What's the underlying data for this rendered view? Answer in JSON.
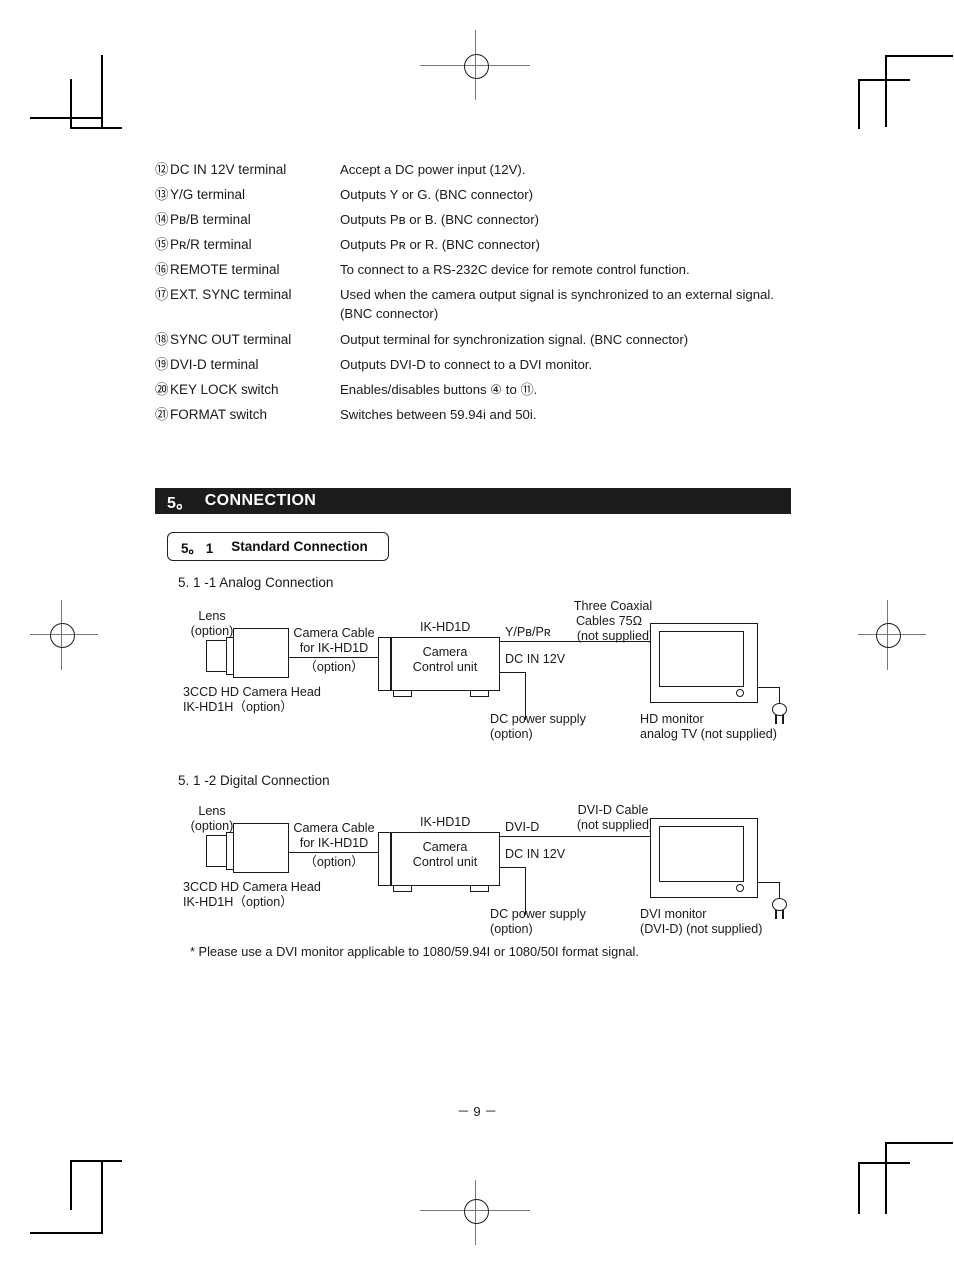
{
  "terminals": {
    "items": [
      {
        "num": "⑫",
        "name": "DC IN 12V terminal",
        "desc": "Accept a DC power input (12V)."
      },
      {
        "num": "⑬",
        "name": "Y/G terminal",
        "desc": "Outputs Y or G. (BNC connector)"
      },
      {
        "num": "⑭",
        "name": "Pʙ/B terminal",
        "desc": "Outputs Pʙ or B. (BNC connector)"
      },
      {
        "num": "⑮",
        "name": "Pʀ/R terminal",
        "desc": "Outputs Pʀ or R. (BNC connector)"
      },
      {
        "num": "⑯",
        "name": "REMOTE terminal",
        "desc": "To connect to a RS-232C device for remote control function."
      },
      {
        "num": "⑰",
        "name": "EXT. SYNC terminal",
        "desc": "Used when the camera output signal is synchronized to an external signal.",
        "desc2": "(BNC connector)"
      },
      {
        "num": "⑱",
        "name": "SYNC OUT terminal",
        "desc": "Output terminal for synchronization signal. (BNC connector)"
      },
      {
        "num": "⑲",
        "name": "DVI-D terminal",
        "desc": "Outputs DVI-D to connect to a DVI monitor."
      },
      {
        "num": "⑳",
        "name": "KEY LOCK switch",
        "desc": "Enables/disables buttons  ④  to  ⑪."
      },
      {
        "num": "㉑",
        "name": "FORMAT switch",
        "desc": "Switches between 59.94i and 50i."
      }
    ]
  },
  "section": {
    "number": "5。",
    "title": "CONNECTION",
    "banner_bg": "#1c1c1c",
    "banner_fg": "#ffffff"
  },
  "subsection": {
    "number": "5。 1",
    "title": "Standard Connection"
  },
  "analog": {
    "heading": "5. 1 -1   Analog Connection",
    "lens_label_1": "Lens",
    "lens_label_2": "(option)",
    "head_label_1": "3CCD HD Camera Head",
    "head_label_2": "IK-HD1H（option）",
    "cable_label_1": "Camera Cable",
    "cable_label_2": "for IK-HD1D",
    "cable_label_3": "（option）",
    "ccu_model": "IK-HD1D",
    "ccu_label_1": "Camera",
    "ccu_label_2": "Control unit",
    "out_label": "Y/Pʙ/Pʀ",
    "dc_label": "DC IN 12V",
    "coax_label_1": "Three Coaxial",
    "coax_label_2": "Cables 75Ω",
    "coax_label_3": "(not supplied)",
    "psu_label_1": "DC power supply",
    "psu_label_2": "(option)",
    "monitor_label_1": "HD monitor",
    "monitor_label_2": "analog TV (not supplied)"
  },
  "digital": {
    "heading": "5. 1 -2   Digital Connection",
    "lens_label_1": "Lens",
    "lens_label_2": "(option)",
    "head_label_1": "3CCD HD Camera Head",
    "head_label_2": "IK-HD1H（option）",
    "cable_label_1": "Camera Cable",
    "cable_label_2": "for IK-HD1D",
    "cable_label_3": "（option）",
    "ccu_model": "IK-HD1D",
    "ccu_label_1": "Camera",
    "ccu_label_2": "Control unit",
    "out_label": "DVI-D",
    "dc_label": "DC IN 12V",
    "dvi_label_1": "DVI-D Cable",
    "dvi_label_2": "(not supplied)",
    "psu_label_1": "DC power supply",
    "psu_label_2": "(option)",
    "monitor_label_1": "DVI monitor",
    "monitor_label_2": "(DVI-D) (not supplied)"
  },
  "note": "* Please use a DVI monitor applicable to 1080/59.94I or 1080/50I format signal.",
  "page_number": "－ 9 －"
}
